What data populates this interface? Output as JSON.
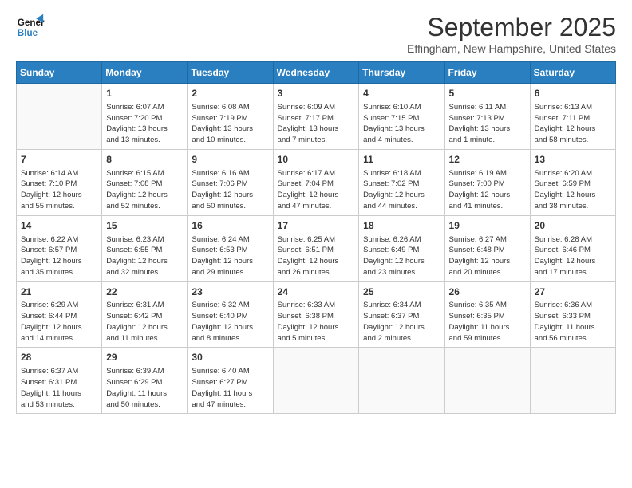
{
  "logo": {
    "line1": "General",
    "line2": "Blue"
  },
  "title": "September 2025",
  "location": "Effingham, New Hampshire, United States",
  "days_of_week": [
    "Sunday",
    "Monday",
    "Tuesday",
    "Wednesday",
    "Thursday",
    "Friday",
    "Saturday"
  ],
  "weeks": [
    [
      {
        "num": "",
        "info": ""
      },
      {
        "num": "1",
        "info": "Sunrise: 6:07 AM\nSunset: 7:20 PM\nDaylight: 13 hours\nand 13 minutes."
      },
      {
        "num": "2",
        "info": "Sunrise: 6:08 AM\nSunset: 7:19 PM\nDaylight: 13 hours\nand 10 minutes."
      },
      {
        "num": "3",
        "info": "Sunrise: 6:09 AM\nSunset: 7:17 PM\nDaylight: 13 hours\nand 7 minutes."
      },
      {
        "num": "4",
        "info": "Sunrise: 6:10 AM\nSunset: 7:15 PM\nDaylight: 13 hours\nand 4 minutes."
      },
      {
        "num": "5",
        "info": "Sunrise: 6:11 AM\nSunset: 7:13 PM\nDaylight: 13 hours\nand 1 minute."
      },
      {
        "num": "6",
        "info": "Sunrise: 6:13 AM\nSunset: 7:11 PM\nDaylight: 12 hours\nand 58 minutes."
      }
    ],
    [
      {
        "num": "7",
        "info": "Sunrise: 6:14 AM\nSunset: 7:10 PM\nDaylight: 12 hours\nand 55 minutes."
      },
      {
        "num": "8",
        "info": "Sunrise: 6:15 AM\nSunset: 7:08 PM\nDaylight: 12 hours\nand 52 minutes."
      },
      {
        "num": "9",
        "info": "Sunrise: 6:16 AM\nSunset: 7:06 PM\nDaylight: 12 hours\nand 50 minutes."
      },
      {
        "num": "10",
        "info": "Sunrise: 6:17 AM\nSunset: 7:04 PM\nDaylight: 12 hours\nand 47 minutes."
      },
      {
        "num": "11",
        "info": "Sunrise: 6:18 AM\nSunset: 7:02 PM\nDaylight: 12 hours\nand 44 minutes."
      },
      {
        "num": "12",
        "info": "Sunrise: 6:19 AM\nSunset: 7:00 PM\nDaylight: 12 hours\nand 41 minutes."
      },
      {
        "num": "13",
        "info": "Sunrise: 6:20 AM\nSunset: 6:59 PM\nDaylight: 12 hours\nand 38 minutes."
      }
    ],
    [
      {
        "num": "14",
        "info": "Sunrise: 6:22 AM\nSunset: 6:57 PM\nDaylight: 12 hours\nand 35 minutes."
      },
      {
        "num": "15",
        "info": "Sunrise: 6:23 AM\nSunset: 6:55 PM\nDaylight: 12 hours\nand 32 minutes."
      },
      {
        "num": "16",
        "info": "Sunrise: 6:24 AM\nSunset: 6:53 PM\nDaylight: 12 hours\nand 29 minutes."
      },
      {
        "num": "17",
        "info": "Sunrise: 6:25 AM\nSunset: 6:51 PM\nDaylight: 12 hours\nand 26 minutes."
      },
      {
        "num": "18",
        "info": "Sunrise: 6:26 AM\nSunset: 6:49 PM\nDaylight: 12 hours\nand 23 minutes."
      },
      {
        "num": "19",
        "info": "Sunrise: 6:27 AM\nSunset: 6:48 PM\nDaylight: 12 hours\nand 20 minutes."
      },
      {
        "num": "20",
        "info": "Sunrise: 6:28 AM\nSunset: 6:46 PM\nDaylight: 12 hours\nand 17 minutes."
      }
    ],
    [
      {
        "num": "21",
        "info": "Sunrise: 6:29 AM\nSunset: 6:44 PM\nDaylight: 12 hours\nand 14 minutes."
      },
      {
        "num": "22",
        "info": "Sunrise: 6:31 AM\nSunset: 6:42 PM\nDaylight: 12 hours\nand 11 minutes."
      },
      {
        "num": "23",
        "info": "Sunrise: 6:32 AM\nSunset: 6:40 PM\nDaylight: 12 hours\nand 8 minutes."
      },
      {
        "num": "24",
        "info": "Sunrise: 6:33 AM\nSunset: 6:38 PM\nDaylight: 12 hours\nand 5 minutes."
      },
      {
        "num": "25",
        "info": "Sunrise: 6:34 AM\nSunset: 6:37 PM\nDaylight: 12 hours\nand 2 minutes."
      },
      {
        "num": "26",
        "info": "Sunrise: 6:35 AM\nSunset: 6:35 PM\nDaylight: 11 hours\nand 59 minutes."
      },
      {
        "num": "27",
        "info": "Sunrise: 6:36 AM\nSunset: 6:33 PM\nDaylight: 11 hours\nand 56 minutes."
      }
    ],
    [
      {
        "num": "28",
        "info": "Sunrise: 6:37 AM\nSunset: 6:31 PM\nDaylight: 11 hours\nand 53 minutes."
      },
      {
        "num": "29",
        "info": "Sunrise: 6:39 AM\nSunset: 6:29 PM\nDaylight: 11 hours\nand 50 minutes."
      },
      {
        "num": "30",
        "info": "Sunrise: 6:40 AM\nSunset: 6:27 PM\nDaylight: 11 hours\nand 47 minutes."
      },
      {
        "num": "",
        "info": ""
      },
      {
        "num": "",
        "info": ""
      },
      {
        "num": "",
        "info": ""
      },
      {
        "num": "",
        "info": ""
      }
    ]
  ]
}
